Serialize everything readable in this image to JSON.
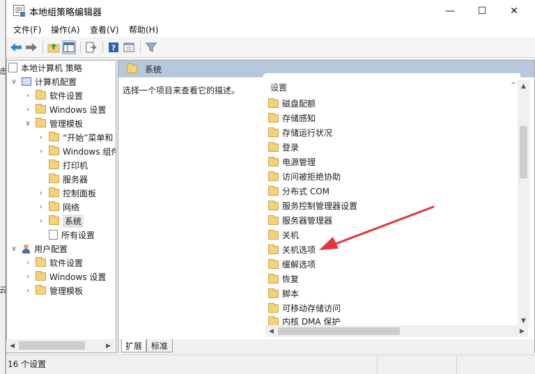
{
  "window": {
    "title": "本地组策略编辑器",
    "minimize_glyph": "—",
    "maximize_glyph": "☐",
    "close_glyph": "✕"
  },
  "menu": [
    "文件(F)",
    "操作(A)",
    "查看(V)",
    "帮助(H)"
  ],
  "toolbar": {
    "icons": [
      "back-icon",
      "forward-icon",
      "up-folder-icon",
      "show-hide-tree-icon",
      "export-list-icon",
      "help-icon",
      "properties-icon",
      "filter-icon"
    ]
  },
  "left_strip": {
    "glyphs": [
      "击",
      "云"
    ]
  },
  "tree": {
    "items": [
      {
        "label": "本地计算机 策略",
        "level": 0,
        "icon": "policy-doc-icon",
        "expander": ""
      },
      {
        "label": "计算机配置",
        "level": 1,
        "icon": "computer-icon",
        "expander": "v"
      },
      {
        "label": "软件设置",
        "level": 2,
        "icon": "folder-icon",
        "expander": ">"
      },
      {
        "label": "Windows 设置",
        "level": 2,
        "icon": "folder-icon",
        "expander": ">"
      },
      {
        "label": "管理模板",
        "level": 2,
        "icon": "folder-icon",
        "expander": "v"
      },
      {
        "label": "“开始”菜单和",
        "level": 3,
        "icon": "folder-icon",
        "expander": ">"
      },
      {
        "label": "Windows 组件",
        "level": 3,
        "icon": "folder-icon",
        "expander": ">"
      },
      {
        "label": "打印机",
        "level": 3,
        "icon": "folder-icon",
        "expander": ""
      },
      {
        "label": "服务器",
        "level": 3,
        "icon": "folder-icon",
        "expander": ""
      },
      {
        "label": "控制面板",
        "level": 3,
        "icon": "folder-icon",
        "expander": ">"
      },
      {
        "label": "网络",
        "level": 3,
        "icon": "folder-icon",
        "expander": ">"
      },
      {
        "label": "系统",
        "level": 3,
        "icon": "folder-icon",
        "expander": ">",
        "selected": true
      },
      {
        "label": "所有设置",
        "level": 3,
        "icon": "all-settings-icon",
        "expander": ""
      },
      {
        "label": "用户配置",
        "level": 1,
        "icon": "user-icon",
        "expander": "v"
      },
      {
        "label": "软件设置",
        "level": 2,
        "icon": "folder-icon",
        "expander": ">"
      },
      {
        "label": "Windows 设置",
        "level": 2,
        "icon": "folder-icon",
        "expander": ">"
      },
      {
        "label": "管理模板",
        "level": 2,
        "icon": "folder-icon",
        "expander": ">"
      }
    ]
  },
  "content": {
    "header_title": "系统",
    "description": "选择一个项目来查看它的描述。",
    "column_header": "设置",
    "items": [
      "磁盘配额",
      "存储感知",
      "存储运行状况",
      "登录",
      "电源管理",
      "访问被拒绝协助",
      "分布式 COM",
      "服务控制管理器设置",
      "服务器管理器",
      "关机",
      "关机选项",
      "缓解选项",
      "恢复",
      "脚本",
      "可移动存储访问",
      "内核 DMA 保护"
    ]
  },
  "tabs": [
    "扩展",
    "标准"
  ],
  "status": {
    "text": "16 个设置"
  },
  "colors": {
    "header_band": "#b5c8dc",
    "folder": "#f3d27a",
    "annotation_arrow": "#e8323c"
  }
}
